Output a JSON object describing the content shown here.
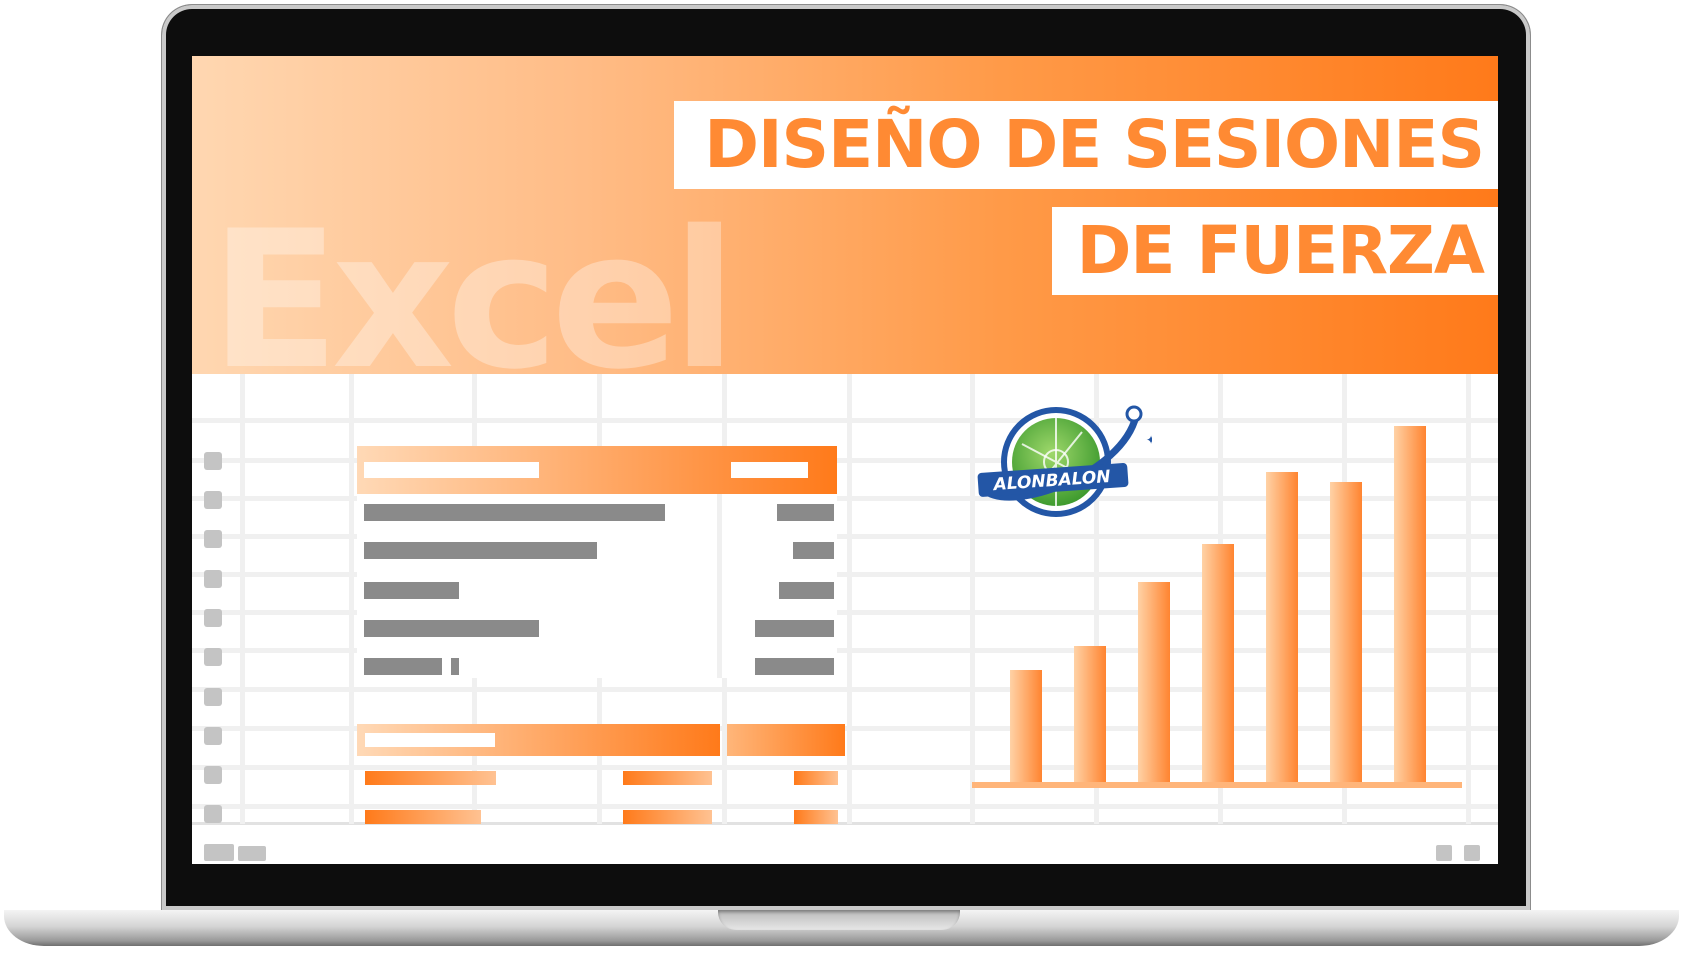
{
  "banner": {
    "background_word": "Excel",
    "title_line1": "DISEÑO DE SESIONES",
    "title_line2": "DE FUERZA",
    "colors": {
      "accent": "#ff8a33",
      "deep": "#ff7a1a",
      "light": "#ffd7b1"
    }
  },
  "logo": {
    "text": "ALONBALON",
    "icon": "alonbalon-logo-icon"
  },
  "chart_data": {
    "type": "bar",
    "categories": [
      "",
      "",
      "",
      "",
      "",
      "",
      ""
    ],
    "values": [
      112,
      136,
      200,
      238,
      310,
      300,
      356
    ],
    "title": "",
    "xlabel": "",
    "ylabel": "",
    "ylim": [
      0,
      360
    ],
    "grid": false
  }
}
